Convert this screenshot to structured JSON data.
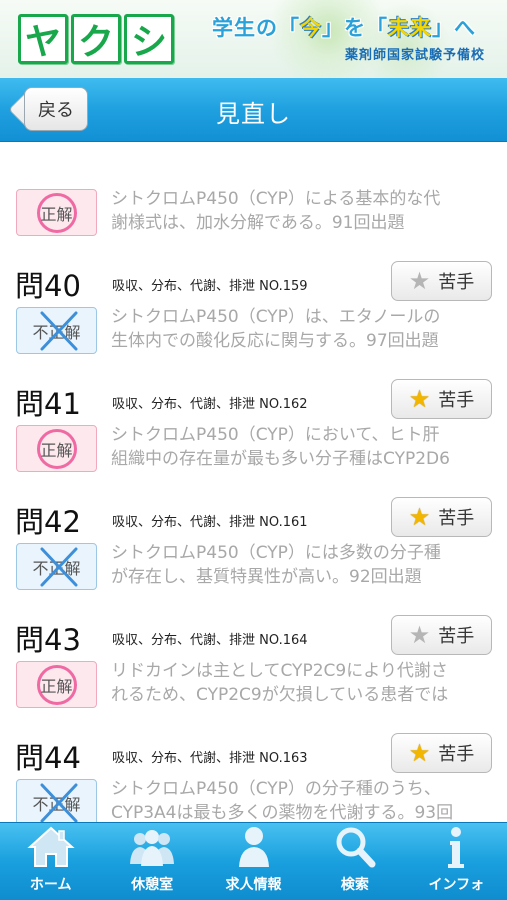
{
  "banner": {
    "logo_chars": [
      "ヤ",
      "ク",
      "シ"
    ],
    "tagline_pre": "学生の「",
    "tagline_now": "今",
    "tagline_mid": "」を「",
    "tagline_future": "未来",
    "tagline_post": "」へ",
    "school": "薬剤師国家試験予備校"
  },
  "navbar": {
    "back_label": "戻る",
    "title": "見直し"
  },
  "colors": {
    "accent": "#1fa0df",
    "star_on": "#f2b600",
    "star_off": "#b5b5b5",
    "correct_circle": "#ef6aa2",
    "wrong_cross": "#3d8fd9"
  },
  "items": [
    {
      "number": "",
      "category": "",
      "starred": null,
      "star_label": "",
      "result": "correct",
      "result_label": "正解",
      "text_line1": "シトクロムP450（CYP）による基本的な代",
      "text_line2": "謝様式は、加水分解である。91回出題"
    },
    {
      "number": "問40",
      "category": "吸収、分布、代謝、排泄 NO.159",
      "starred": false,
      "star_label": "苦手",
      "result": "wrong",
      "result_label": "不正解",
      "text_line1": "シトクロムP450（CYP）は、エタノールの",
      "text_line2": "生体内での酸化反応に関与する。97回出題"
    },
    {
      "number": "問41",
      "category": "吸収、分布、代謝、排泄 NO.162",
      "starred": true,
      "star_label": "苦手",
      "result": "correct",
      "result_label": "正解",
      "text_line1": "シトクロムP450（CYP）において、ヒト肝",
      "text_line2": "組織中の存在量が最も多い分子種はCYP2D6"
    },
    {
      "number": "問42",
      "category": "吸収、分布、代謝、排泄 NO.161",
      "starred": true,
      "star_label": "苦手",
      "result": "wrong",
      "result_label": "不正解",
      "text_line1": "シトクロムP450（CYP）には多数の分子種",
      "text_line2": "が存在し、基質特異性が高い。92回出題"
    },
    {
      "number": "問43",
      "category": "吸収、分布、代謝、排泄 NO.164",
      "starred": false,
      "star_label": "苦手",
      "result": "correct",
      "result_label": "正解",
      "text_line1": "リドカインは主としてCYP2C9により代謝さ",
      "text_line2": "れるため、CYP2C9が欠損している患者では"
    },
    {
      "number": "問44",
      "category": "吸収、分布、代謝、排泄 NO.163",
      "starred": true,
      "star_label": "苦手",
      "result": "wrong",
      "result_label": "不正解",
      "text_line1": "シトクロムP450（CYP）の分子種のうち、",
      "text_line2": "CYP3A4は最も多くの薬物を代謝する。93回"
    }
  ],
  "tabs": [
    {
      "label": "ホーム",
      "icon": "home-icon"
    },
    {
      "label": "休憩室",
      "icon": "people-icon"
    },
    {
      "label": "求人情報",
      "icon": "person-icon"
    },
    {
      "label": "検索",
      "icon": "search-icon"
    },
    {
      "label": "インフォ",
      "icon": "info-icon"
    }
  ]
}
